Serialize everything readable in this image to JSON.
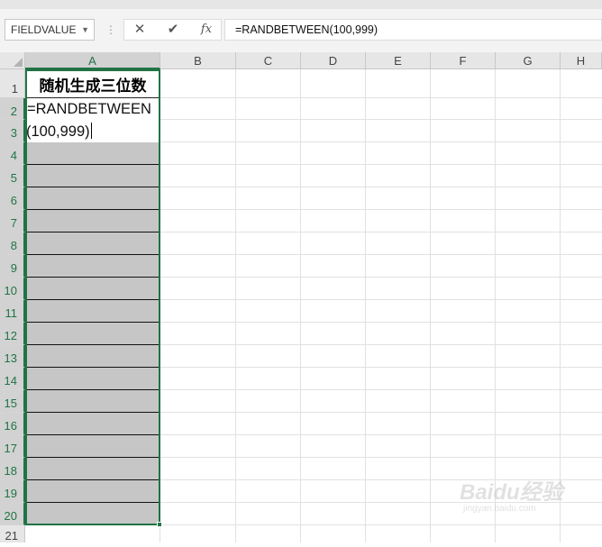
{
  "name_box": {
    "value": "FIELDVALUE",
    "dropdown_glyph": "▼"
  },
  "formula_bar": {
    "more_glyph": "⋮",
    "cancel_glyph": "✕",
    "enter_glyph": "✔",
    "fx_label": "fx",
    "content": "=RANDBETWEEN(100,999)"
  },
  "columns": [
    "A",
    "B",
    "C",
    "D",
    "E",
    "F",
    "G",
    "H"
  ],
  "rows": [
    "1",
    "2",
    "3",
    "4",
    "5",
    "6",
    "7",
    "8",
    "9",
    "10",
    "11",
    "12",
    "13",
    "14",
    "15",
    "16",
    "17",
    "18",
    "19",
    "20",
    "21"
  ],
  "cells": {
    "A1": "随机生成三位数",
    "edit_line1": "=RANDBETWEEN",
    "edit_line2": "(100,999)"
  },
  "selection": {
    "range": "A2:A20",
    "active_column": "A"
  },
  "colors": {
    "accent": "#217346",
    "selected_fill": "#c6c6c6",
    "header_bg": "#e6e6e6"
  },
  "watermark": {
    "brand": "Baidu经验",
    "site": "jingyan.baidu.com"
  }
}
